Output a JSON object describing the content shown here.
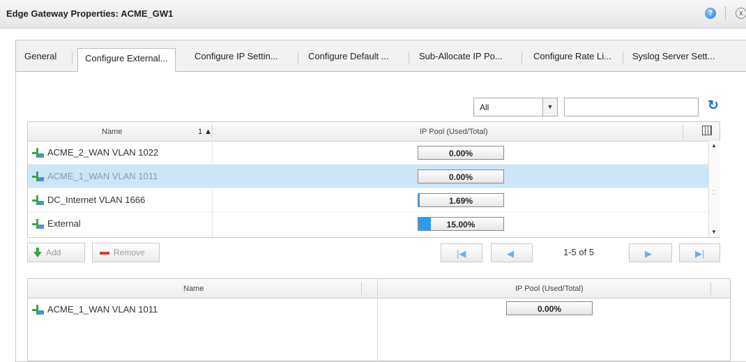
{
  "window": {
    "title": "Edge Gateway Properties: ACME_GW1",
    "help": "?",
    "close": "x"
  },
  "tabs": [
    {
      "label": "General"
    },
    {
      "label": "Configure External..."
    },
    {
      "label": "Configure IP Settin..."
    },
    {
      "label": "Configure Default ..."
    },
    {
      "label": "Sub-Allocate IP Po..."
    },
    {
      "label": "Configure Rate Li..."
    },
    {
      "label": "Syslog Server Sett..."
    }
  ],
  "filter": {
    "selected": "All",
    "search_value": ""
  },
  "upper_grid": {
    "col_name": "Name",
    "sort_indicator": "1 ▲",
    "col_pool": "IP Pool (Used/Total)",
    "rows": [
      {
        "name": "ACME_2_WAN VLAN 1022",
        "pool": "0.00%",
        "fill": 0.0
      },
      {
        "name": "ACME_1_WAN VLAN 1011",
        "pool": "0.00%",
        "fill": 0.0
      },
      {
        "name": "DC_Internet VLAN 1666",
        "pool": "1.69%",
        "fill": 0.0169
      },
      {
        "name": "External",
        "pool": "15.00%",
        "fill": 0.15
      }
    ]
  },
  "toolbar": {
    "add": "Add",
    "remove": "Remove"
  },
  "pager": {
    "text": "1-5 of 5"
  },
  "lower_grid": {
    "col_name": "Name",
    "col_pool": "IP Pool (Used/Total)",
    "rows": [
      {
        "name": "ACME_1_WAN VLAN 1011",
        "pool": "0.00%",
        "fill": 0.0
      }
    ]
  },
  "colors": {
    "selected_row": "#cde6f7",
    "accent": "#2e9bf0",
    "remove_red": "#d23b3b"
  }
}
